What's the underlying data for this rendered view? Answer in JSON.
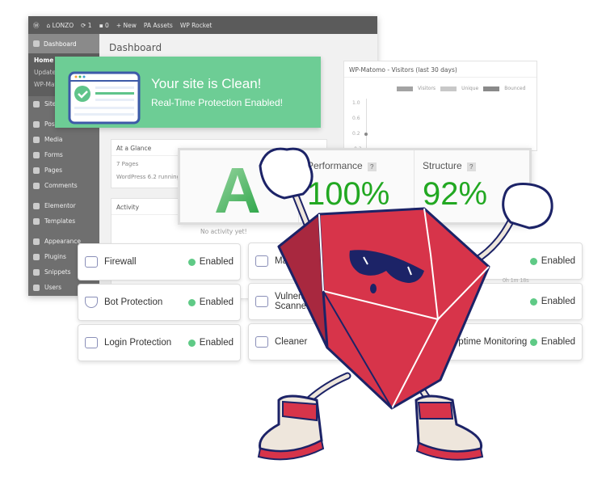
{
  "adminbar": {
    "site": "LONZO",
    "updates": "1",
    "comments": "0",
    "new": "+ New",
    "pa_assets": "PA Assets",
    "wp_rocket": "WP Rocket"
  },
  "sidebar": {
    "dashboard": "Dashboard",
    "sub": [
      "Home",
      "Updates",
      "WP-Matomo"
    ],
    "items": [
      "Site Kit",
      "Posts",
      "Media",
      "Forms",
      "Pages",
      "Comments",
      "Elementor",
      "Templates",
      "Appearance",
      "Plugins",
      "Snippets",
      "Users"
    ]
  },
  "page_title": "Dashboard",
  "matomo": {
    "title": "WP-Matomo - Visitors (last 30 days)",
    "legend": [
      "Visitors",
      "Unique",
      "Bounced"
    ],
    "yticks": [
      "1.0",
      "0.6",
      "0.2",
      "-0.2"
    ]
  },
  "glance": {
    "title": "At a Glance",
    "pages": "7 Pages",
    "version": "WordPress 6.2 running H"
  },
  "activity": {
    "title": "Activity",
    "empty": "No activity yet!",
    "time": "0h 1m 18s"
  },
  "banner": {
    "title": "Your site is Clean!",
    "subtitle": "Real-Time Protection Enabled!"
  },
  "grade": {
    "letter": "A",
    "performance_label": "Performance",
    "performance": "100%",
    "structure_label": "Structure",
    "structure": "92%",
    "help": "?"
  },
  "features": [
    {
      "label": "Firewall",
      "status": "Enabled"
    },
    {
      "label": "Bot Protection",
      "status": "Enabled"
    },
    {
      "label": "Login Protection",
      "status": "Enabled"
    },
    {
      "label": "Malware Scanner"
    },
    {
      "label": "Vulnerability Scanner"
    },
    {
      "label": "Cleaner"
    },
    {
      "label": "",
      "status": "Enabled"
    },
    {
      "label": "",
      "status": "Enabled"
    },
    {
      "label": "Uptime Monitoring",
      "status": "Enabled"
    }
  ],
  "colors": {
    "green": "#6dcd95",
    "ruby": "#d7344a",
    "navy": "#1c2367"
  }
}
